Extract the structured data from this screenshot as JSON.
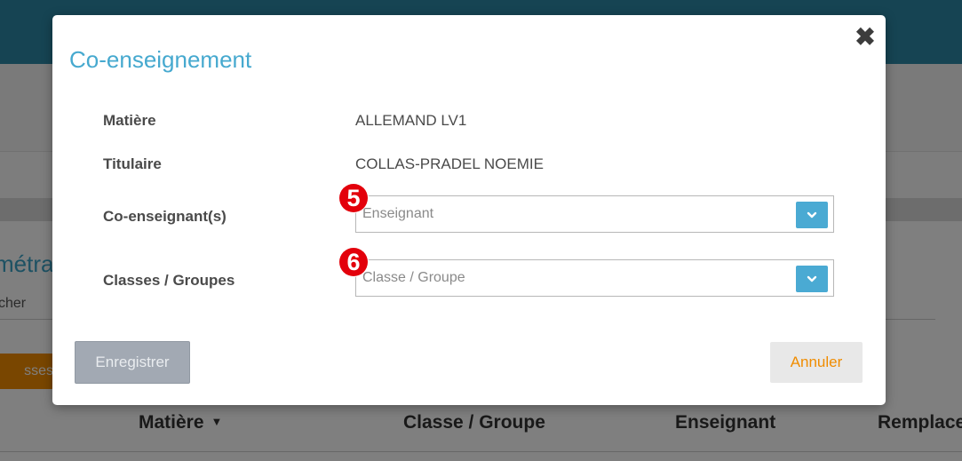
{
  "background": {
    "title_fragment": "métra",
    "search_fragment": "cher",
    "orange_button_fragment": "sses",
    "table_headers": [
      "Matière",
      "Classe / Groupe",
      "Enseignant",
      "Remplace"
    ]
  },
  "modal": {
    "title": "Co-enseignement",
    "close_icon": "✖",
    "fields": {
      "matiere_label": "Matière",
      "matiere_value": "ALLEMAND LV1",
      "titulaire_label": "Titulaire",
      "titulaire_value": "COLLAS-PRADEL NOEMIE",
      "coenseignant_label": "Co-enseignant(s)",
      "coenseignant_placeholder": "Enseignant",
      "classes_label": "Classes / Groupes",
      "classes_placeholder": "Classe / Groupe"
    },
    "markers": [
      "5",
      "6"
    ],
    "buttons": {
      "save": "Enregistrer",
      "cancel": "Annuler"
    }
  },
  "colors": {
    "accent": "#46a9cf",
    "marker": "#e3000b",
    "cancel_text": "#f08c00"
  }
}
